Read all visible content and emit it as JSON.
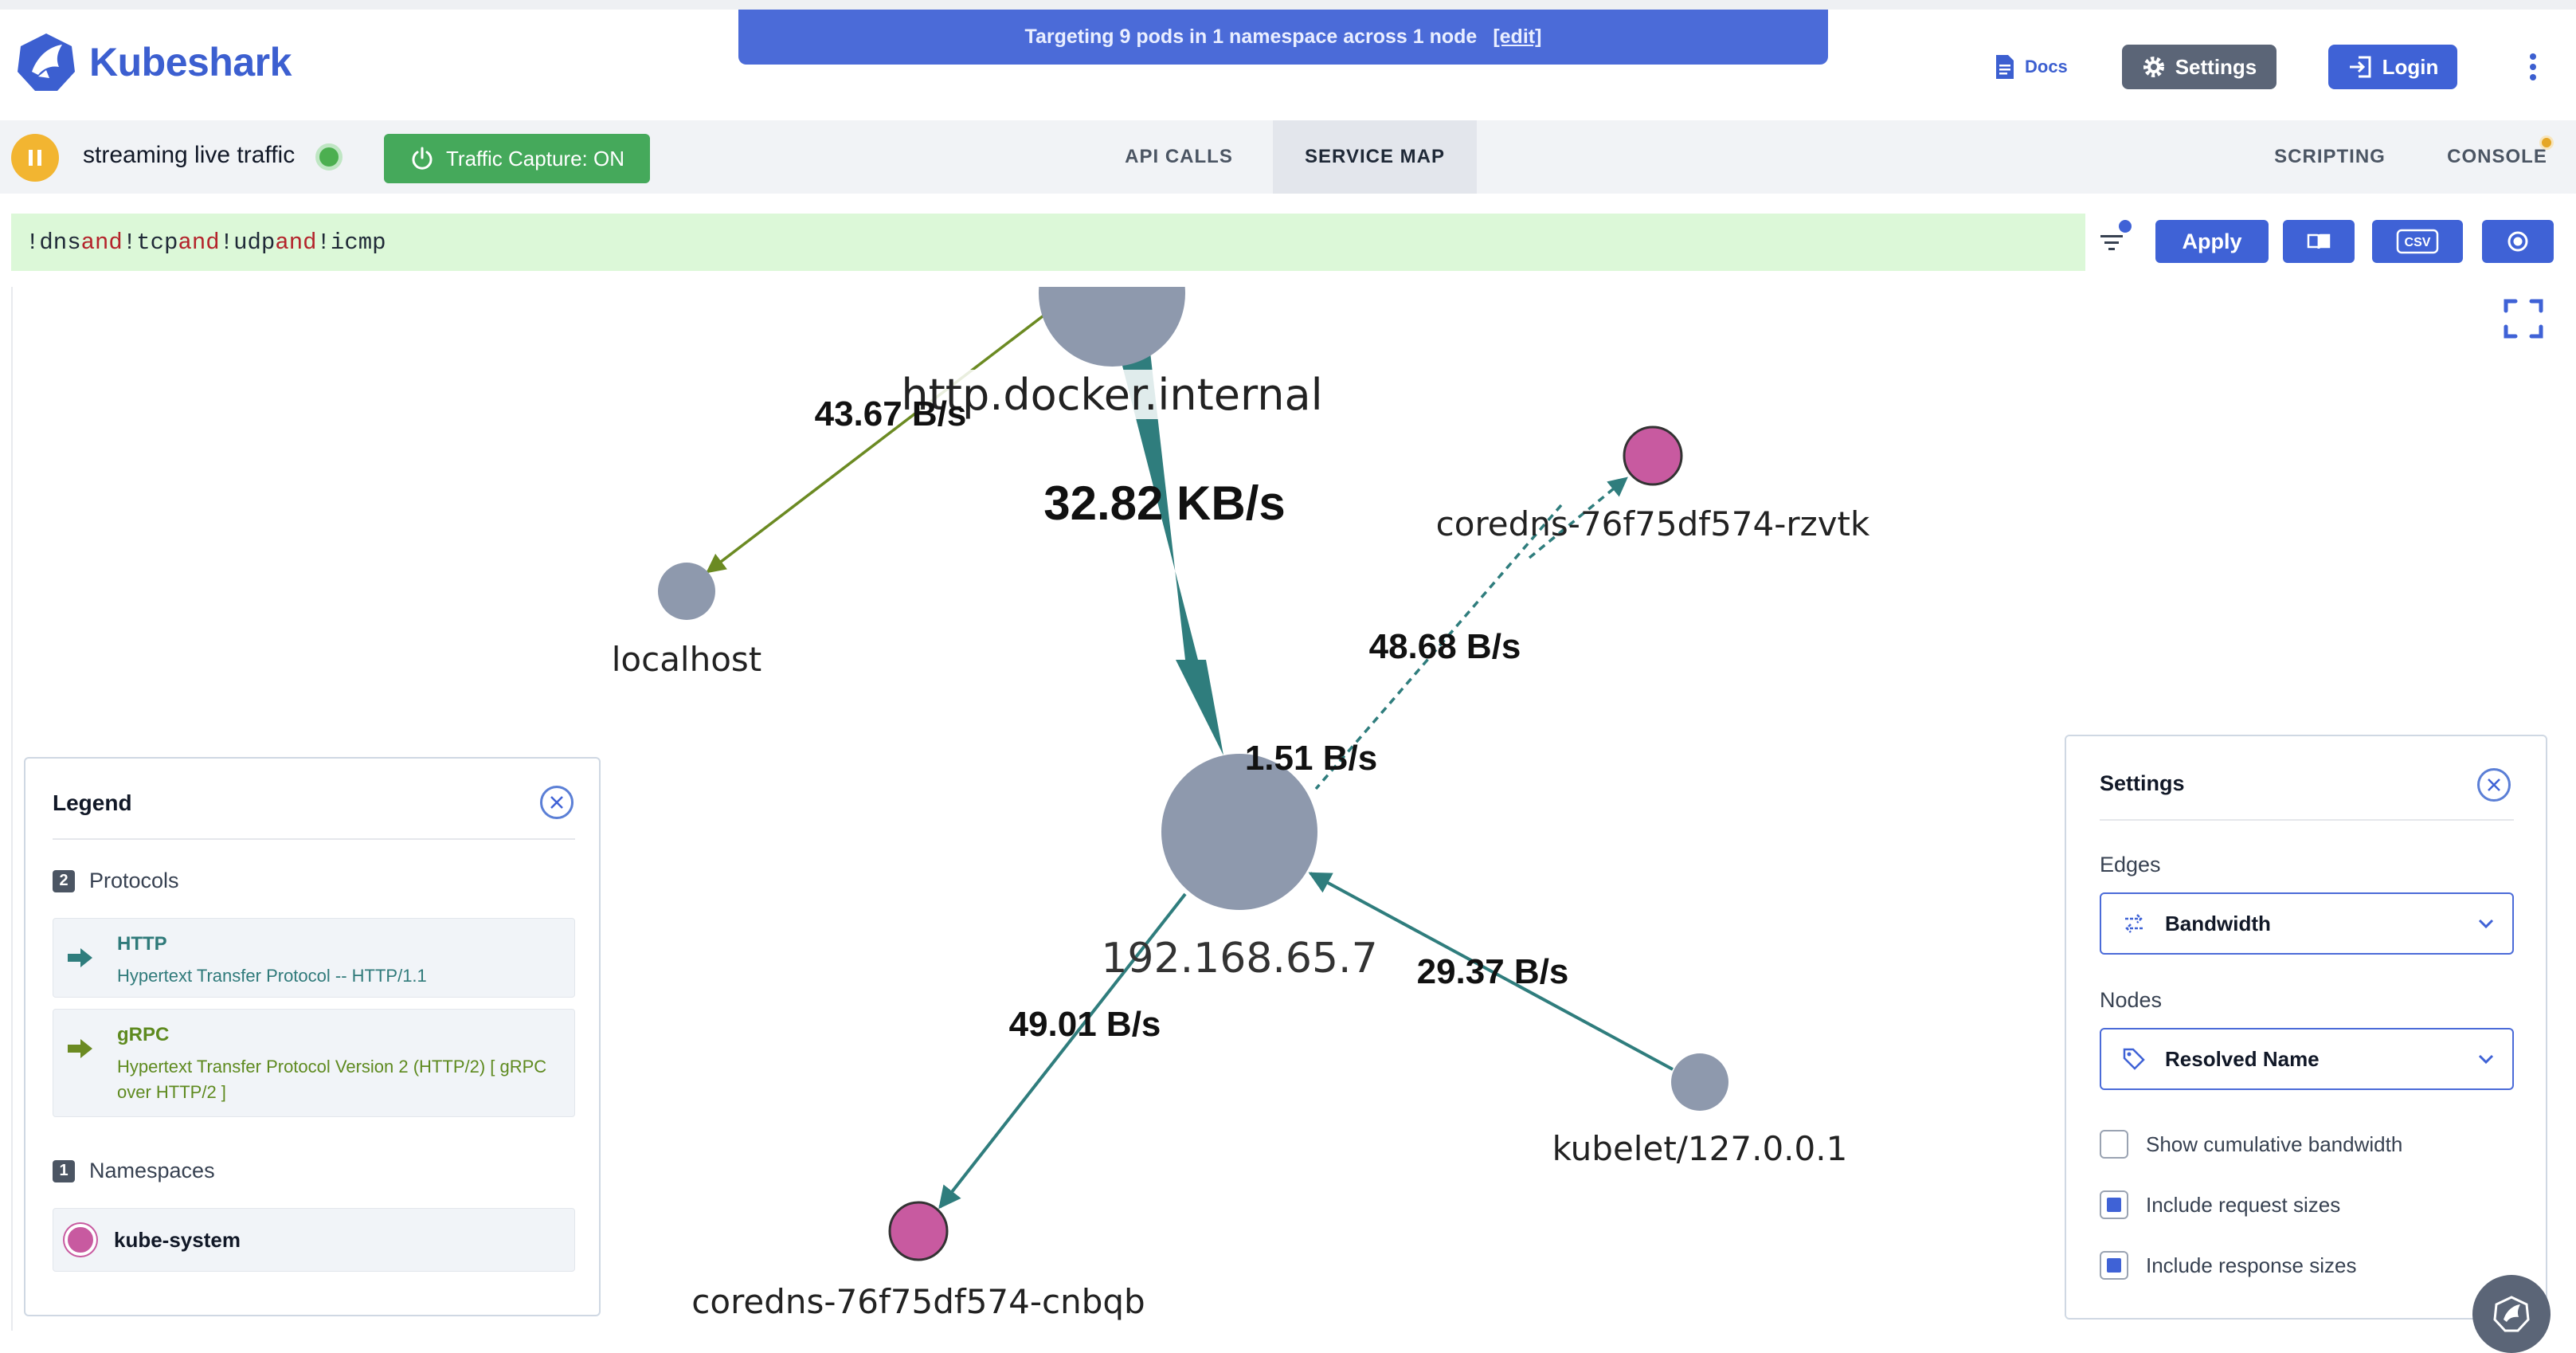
{
  "banner": {
    "text": "Targeting 9 pods in 1 namespace across 1 node",
    "edit": "[edit]"
  },
  "brand": {
    "name": "Kubeshark",
    "logo_icon": "kubeshark-shark-icon",
    "color": "#3c5fd0"
  },
  "header": {
    "docs_label": "Docs",
    "settings_label": "Settings",
    "login_label": "Login"
  },
  "status": {
    "streaming_text": "streaming live traffic",
    "capture_label": "Traffic Capture: ON"
  },
  "tabs": {
    "api_calls": "API CALLS",
    "service_map": "SERVICE MAP",
    "scripting": "SCRIPTING",
    "console": "CONSOLE",
    "active": "SERVICE MAP"
  },
  "query": {
    "tokens": [
      "!dns",
      "and",
      "!tcp",
      "and",
      "!udp",
      "and",
      "!icmp"
    ],
    "apply_label": "Apply",
    "csv_label": "CSV"
  },
  "graph": {
    "nodes": {
      "docker": "http.docker.internal",
      "localhost": "localhost",
      "coredns_rzvtk": "coredns-76f75df574-rzvtk",
      "center": "192.168.65.7",
      "kubelet": "kubelet/127.0.0.1",
      "coredns_cnbqb": "coredns-76f75df574-cnbqb"
    },
    "edges": {
      "docker_localhost": "43.67 B/s",
      "docker_center": "32.82 KB/s",
      "center_rzvtk": "48.68 B/s",
      "rzvtk_center": "1.51 B/s",
      "kubelet_center": "29.37 B/s",
      "center_cnbqb": "49.01 B/s"
    },
    "colors": {
      "http": "#2f7d7d",
      "grpc": "#6b8a22",
      "node": "#8e99ad",
      "namespace_node": "#c85aa0"
    }
  },
  "legend": {
    "title": "Legend",
    "protocols_title": "Protocols",
    "protocols_count": "2",
    "protocols": [
      {
        "name": "HTTP",
        "description": "Hypertext Transfer Protocol -- HTTP/1.1"
      },
      {
        "name": "gRPC",
        "description": "Hypertext Transfer Protocol Version 2 (HTTP/2) [ gRPC over HTTP/2 ]"
      }
    ],
    "namespaces_title": "Namespaces",
    "namespaces_count": "1",
    "namespaces": [
      "kube-system"
    ]
  },
  "settings_panel": {
    "title": "Settings",
    "edges_label": "Edges",
    "edges_value": "Bandwidth",
    "nodes_label": "Nodes",
    "nodes_value": "Resolved Name",
    "options": [
      {
        "label": "Show cumulative bandwidth",
        "checked": false
      },
      {
        "label": "Include request sizes",
        "checked": true
      },
      {
        "label": "Include response sizes",
        "checked": true
      }
    ]
  }
}
